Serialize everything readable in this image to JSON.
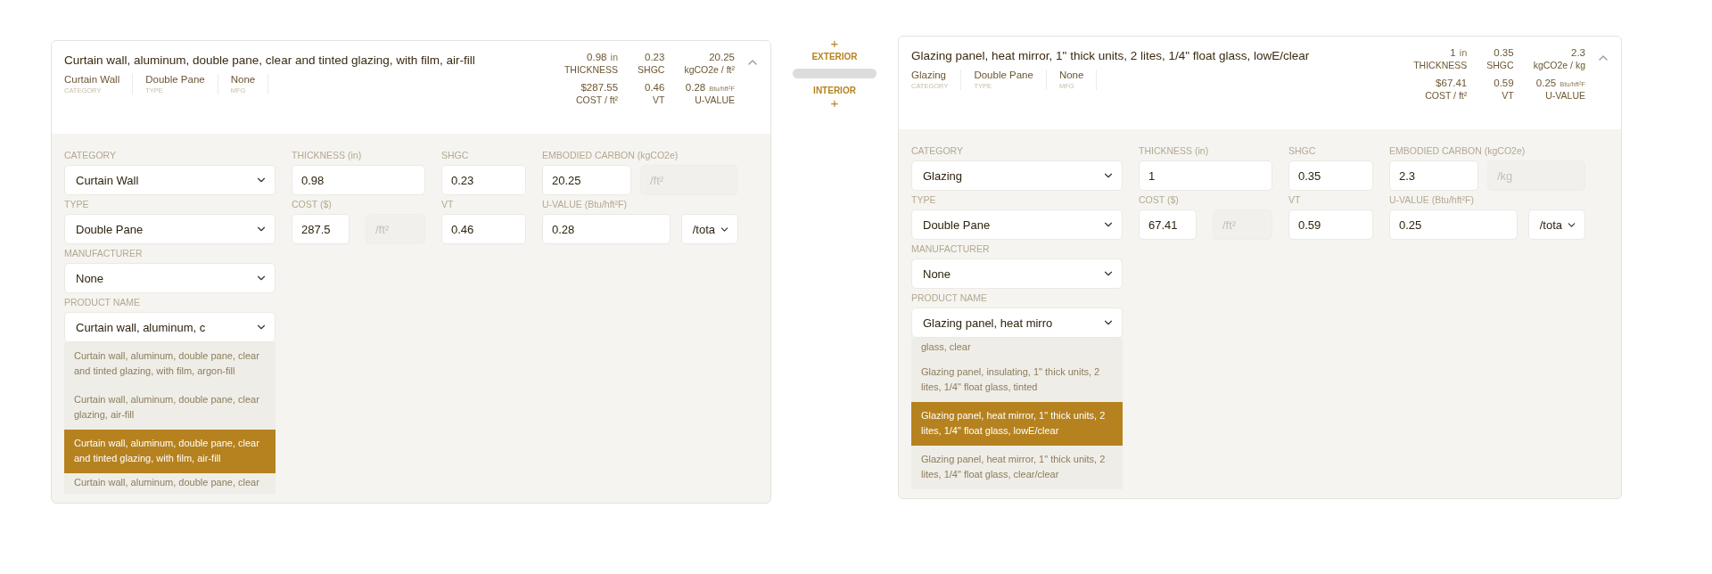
{
  "panels": [
    {
      "title": "Curtain wall, aluminum, double pane, clear and tinted glazing, with film, air-fill",
      "expanded": true,
      "tags": [
        {
          "value": "Curtain Wall",
          "label": "CATEGORY"
        },
        {
          "value": "Double Pane",
          "label": "TYPE"
        },
        {
          "value": "None",
          "label": "MFG"
        }
      ],
      "metrics": [
        {
          "value": "0.98",
          "unit": "in",
          "label": "THICKNESS"
        },
        {
          "value": "0.23",
          "label": "SHGC"
        },
        {
          "value": "20.25",
          "label": "kgCO2e / ft²"
        },
        {
          "value": "$287.55",
          "label": "COST / ft²"
        },
        {
          "value": "0.46",
          "label": "VT"
        },
        {
          "value": "0.28",
          "unit": "Btu/hft²F",
          "label": "U-VALUE"
        }
      ],
      "form": {
        "category": {
          "label": "CATEGORY",
          "value": "Curtain Wall"
        },
        "type": {
          "label": "TYPE",
          "value": "Double Pane"
        },
        "manufacturer": {
          "label": "MANUFACTURER",
          "value": "None"
        },
        "product_name": {
          "label": "PRODUCT NAME",
          "value": "Curtain wall, aluminum, c",
          "options": [
            {
              "text": "Curtain wall, aluminum, double pane, clear and tinted glazing, with film, argon-fill",
              "selected": false
            },
            {
              "text": "Curtain wall, aluminum, double pane, clear glazing, air-fill",
              "selected": false
            },
            {
              "text": "Curtain wall, aluminum, double pane, clear and tinted glazing, with film, air-fill",
              "selected": true
            },
            {
              "text": "Curtain wall, aluminum, double pane, clear",
              "selected": false
            }
          ]
        },
        "thickness": {
          "label": "THICKNESS (in)",
          "value": "0.98"
        },
        "cost": {
          "label": "COST ($)",
          "value": "287.5",
          "unit": "/ft²"
        },
        "shgc": {
          "label": "SHGC",
          "value": "0.23"
        },
        "vt": {
          "label": "VT",
          "value": "0.46"
        },
        "embodied_carbon": {
          "label": "EMBODIED CARBON (kgCO2e)",
          "value": "20.25",
          "unit": "/ft²"
        },
        "u_value": {
          "label": "U-VALUE (Btu/hft²F)",
          "value": "0.28",
          "unit": "/tota"
        }
      }
    },
    {
      "title": "Glazing panel, heat mirror, 1\" thick units, 2 lites, 1/4\" float glass, lowE/clear",
      "expanded": true,
      "tags": [
        {
          "value": "Glazing",
          "label": "CATEGORY"
        },
        {
          "value": "Double Pane",
          "label": "TYPE"
        },
        {
          "value": "None",
          "label": "MFG"
        }
      ],
      "metrics": [
        {
          "value": "1",
          "unit": "in",
          "label": "THICKNESS"
        },
        {
          "value": "0.35",
          "label": "SHGC"
        },
        {
          "value": "2.3",
          "label": "kgCO2e / kg"
        },
        {
          "value": "$67.41",
          "label": "COST / ft²"
        },
        {
          "value": "0.59",
          "label": "VT"
        },
        {
          "value": "0.25",
          "unit": "Btu/hft²F",
          "label": "U-VALUE"
        }
      ],
      "form": {
        "category": {
          "label": "CATEGORY",
          "value": "Glazing"
        },
        "type": {
          "label": "TYPE",
          "value": "Double Pane"
        },
        "manufacturer": {
          "label": "MANUFACTURER",
          "value": "None"
        },
        "product_name": {
          "label": "PRODUCT NAME",
          "value": "Glazing panel, heat mirro",
          "options": [
            {
              "text": "glass, clear",
              "selected": false
            },
            {
              "text": "Glazing panel, insulating, 1\" thick units, 2 lites, 1/4\" float glass, tinted",
              "selected": false
            },
            {
              "text": "Glazing panel, heat mirror, 1\" thick units, 2 lites, 1/4\" float glass, lowE/clear",
              "selected": true
            },
            {
              "text": "Glazing panel, heat mirror, 1\" thick units, 2 lites, 1/4\" float glass, clear/clear",
              "selected": false
            }
          ]
        },
        "thickness": {
          "label": "THICKNESS (in)",
          "value": "1"
        },
        "cost": {
          "label": "COST ($)",
          "value": "67.41",
          "unit": "/ft²"
        },
        "shgc": {
          "label": "SHGC",
          "value": "0.35"
        },
        "vt": {
          "label": "VT",
          "value": "0.59"
        },
        "embodied_carbon": {
          "label": "EMBODIED CARBON (kgCO2e)",
          "value": "2.3",
          "unit": "/kg"
        },
        "u_value": {
          "label": "U-VALUE (Btu/hft²F)",
          "value": "0.25",
          "unit": "/tota"
        }
      }
    }
  ],
  "divider": {
    "top_icon": "+",
    "exterior": "EXTERIOR",
    "interior": "INTERIOR",
    "bottom_icon": "+"
  }
}
